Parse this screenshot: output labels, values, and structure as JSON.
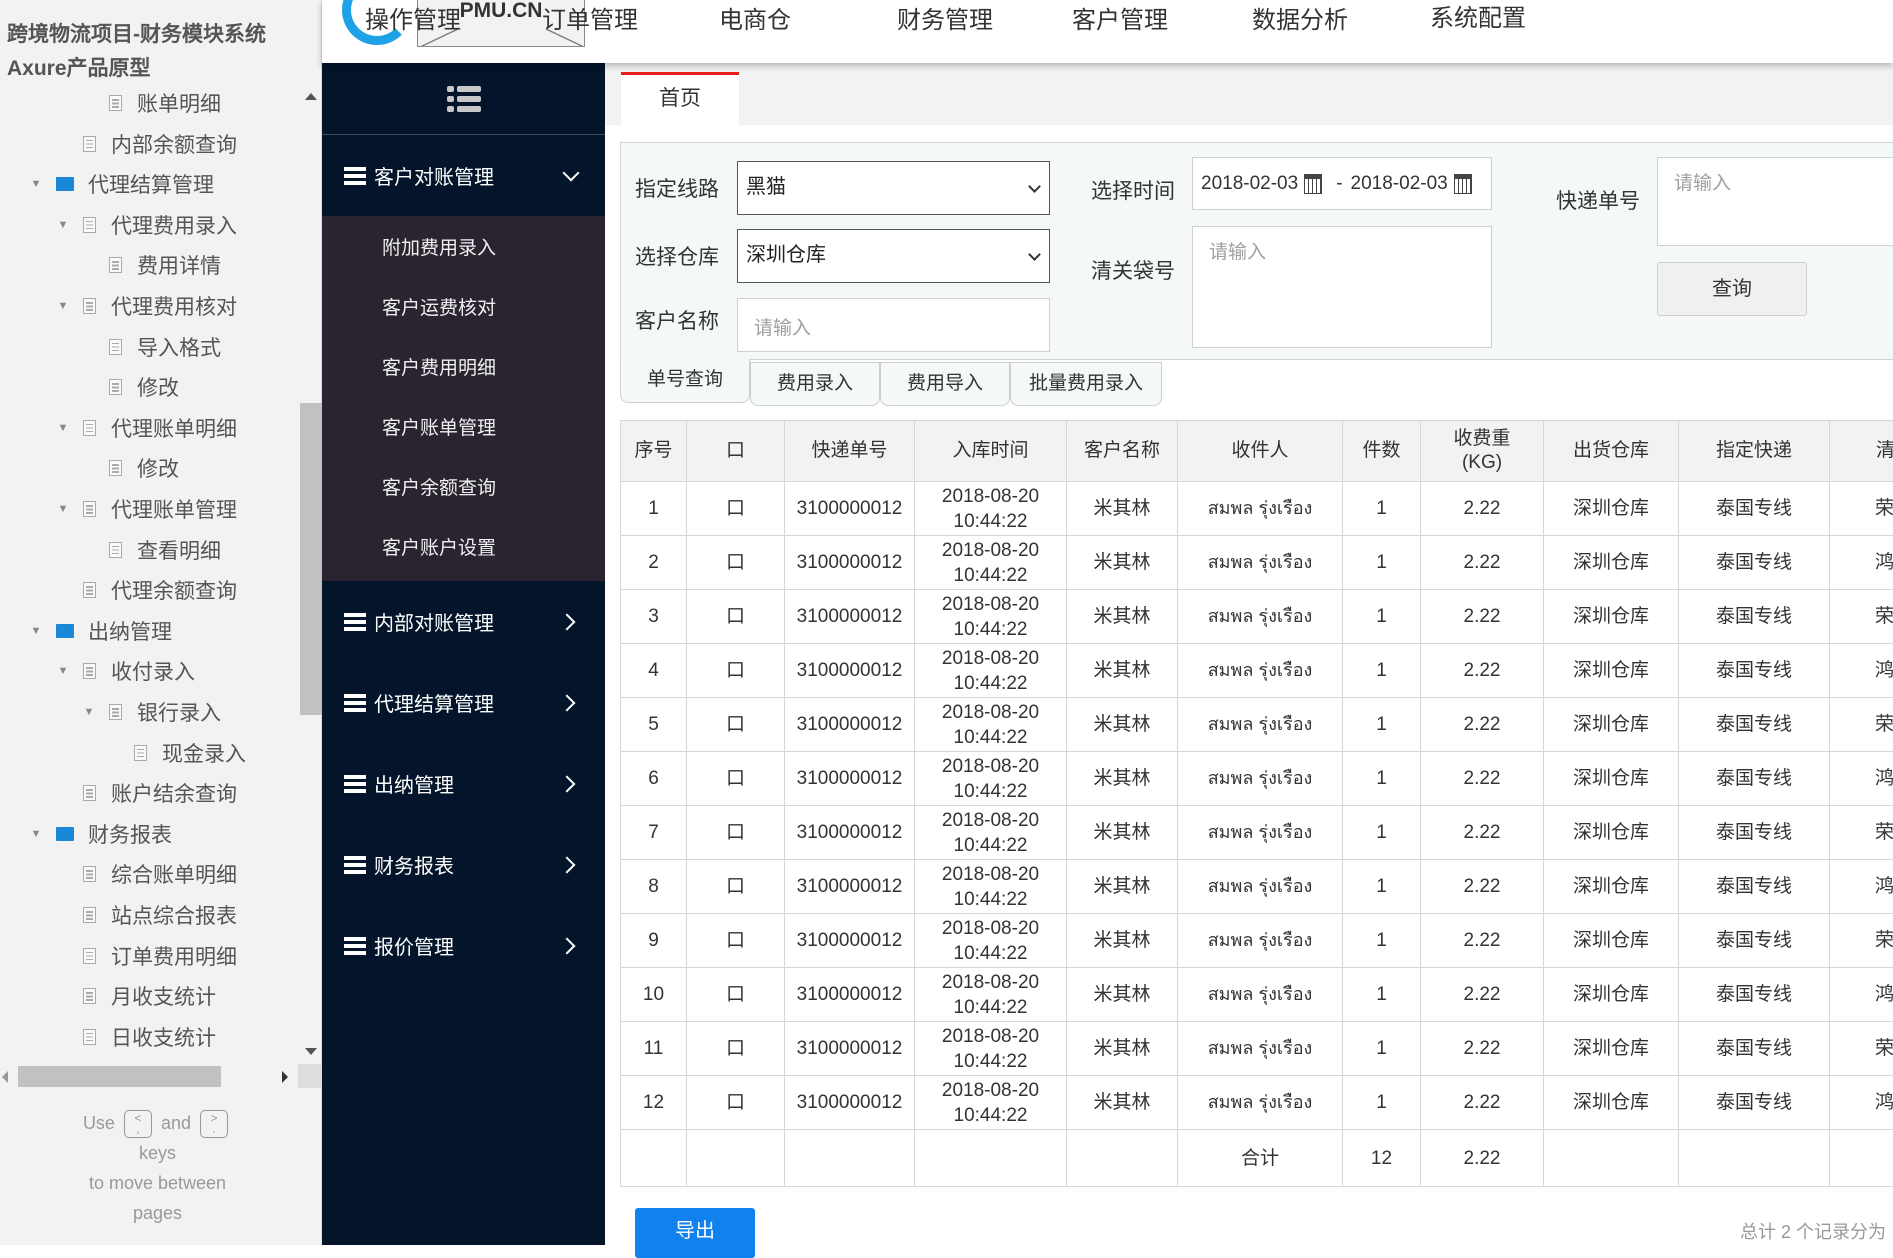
{
  "axure": {
    "project_title": "跨境物流项目-财务模块系统Axure产品原型",
    "tree": [
      {
        "label": "账单明细",
        "level": 3,
        "type": "page",
        "expander": false
      },
      {
        "label": "内部余额查询",
        "level": 2,
        "type": "page",
        "expander": false
      },
      {
        "label": "代理结算管理",
        "level": 1,
        "type": "folder",
        "expander": true
      },
      {
        "label": "代理费用录入",
        "level": 2,
        "type": "page",
        "expander": true
      },
      {
        "label": "费用详情",
        "level": 3,
        "type": "page",
        "expander": false
      },
      {
        "label": "代理费用核对",
        "level": 2,
        "type": "page",
        "expander": true
      },
      {
        "label": "导入格式",
        "level": 3,
        "type": "page",
        "expander": false
      },
      {
        "label": "修改",
        "level": 3,
        "type": "page",
        "expander": false
      },
      {
        "label": "代理账单明细",
        "level": 2,
        "type": "page",
        "expander": true
      },
      {
        "label": "修改",
        "level": 3,
        "type": "page",
        "expander": false
      },
      {
        "label": "代理账单管理",
        "level": 2,
        "type": "page",
        "expander": true
      },
      {
        "label": "查看明细",
        "level": 3,
        "type": "page",
        "expander": false
      },
      {
        "label": "代理余额查询",
        "level": 2,
        "type": "page",
        "expander": false
      },
      {
        "label": "出纳管理",
        "level": 1,
        "type": "folder",
        "expander": true
      },
      {
        "label": "收付录入",
        "level": 2,
        "type": "page",
        "expander": true
      },
      {
        "label": "银行录入",
        "level": 3,
        "type": "page",
        "expander": true
      },
      {
        "label": "现金录入",
        "level": 4,
        "type": "page",
        "expander": false
      },
      {
        "label": "账户结余查询",
        "level": 2,
        "type": "page",
        "expander": false
      },
      {
        "label": "财务报表",
        "level": 1,
        "type": "folder",
        "expander": true
      },
      {
        "label": "综合账单明细",
        "level": 2,
        "type": "page",
        "expander": false
      },
      {
        "label": "站点综合报表",
        "level": 2,
        "type": "page",
        "expander": false
      },
      {
        "label": "订单费用明细",
        "level": 2,
        "type": "page",
        "expander": false
      },
      {
        "label": "月收支统计",
        "level": 2,
        "type": "page",
        "expander": false
      },
      {
        "label": "日收支统计",
        "level": 2,
        "type": "page",
        "expander": false
      }
    ],
    "hint": {
      "use": "Use",
      "and": "and",
      "key_prev": "<\n,",
      "key_next": ">\n.",
      "keys": "keys",
      "line2": "to move between",
      "line3": "pages"
    }
  },
  "header": {
    "logo_text": "PMU.CN",
    "nav": [
      "操作管理",
      "订单管理",
      "电商仓",
      "财务管理",
      "客户管理",
      "数据分析",
      "系统配置"
    ]
  },
  "sidenav": {
    "groups": [
      {
        "label": "客户对账管理",
        "expanded": true,
        "items": [
          "附加费用录入",
          "客户运费核对",
          "客户费用明细",
          "客户账单管理",
          "客户余额查询",
          "客户账户设置"
        ]
      },
      {
        "label": "内部对账管理",
        "expanded": false
      },
      {
        "label": "代理结算管理",
        "expanded": false
      },
      {
        "label": "出纳管理",
        "expanded": false
      },
      {
        "label": "财务报表",
        "expanded": false
      },
      {
        "label": "报价管理",
        "expanded": false
      }
    ]
  },
  "tabs": {
    "home": "首页"
  },
  "filter": {
    "route_label": "指定线路",
    "route_value": "黑猫",
    "warehouse_label": "选择仓库",
    "warehouse_value": "深圳仓库",
    "customer_label": "客户名称",
    "customer_placeholder": "请输入",
    "time_label": "选择时间",
    "date_from": "2018-02-03",
    "date_sep": "-",
    "date_to": "2018-02-03",
    "bag_label": "清关袋号",
    "bag_placeholder": "请输入",
    "tracking_label": "快递单号",
    "tracking_placeholder": "请输入",
    "query_button": "查询"
  },
  "query_tabs": [
    "单号查询",
    "费用录入",
    "费用导入",
    "批量费用录入"
  ],
  "table": {
    "columns": [
      "序号",
      "口",
      "快递单号",
      "入库时间",
      "客户名称",
      "收件人",
      "件数",
      "收费重\n(KG)",
      "出货仓库",
      "指定快递",
      "清关"
    ],
    "rows": [
      [
        "1",
        "口",
        "3100000012",
        "2018-08-20\n10:44:22",
        "米其林",
        "สมพล รุ่งเรือง",
        "1",
        "2.22",
        "深圳仓库",
        "泰国专线",
        "荣"
      ],
      [
        "2",
        "口",
        "3100000012",
        "2018-08-20\n10:44:22",
        "米其林",
        "สมพล รุ่งเรือง",
        "1",
        "2.22",
        "深圳仓库",
        "泰国专线",
        "鸿"
      ],
      [
        "3",
        "口",
        "3100000012",
        "2018-08-20\n10:44:22",
        "米其林",
        "สมพล รุ่งเรือง",
        "1",
        "2.22",
        "深圳仓库",
        "泰国专线",
        "荣"
      ],
      [
        "4",
        "口",
        "3100000012",
        "2018-08-20\n10:44:22",
        "米其林",
        "สมพล รุ่งเรือง",
        "1",
        "2.22",
        "深圳仓库",
        "泰国专线",
        "鸿"
      ],
      [
        "5",
        "口",
        "3100000012",
        "2018-08-20\n10:44:22",
        "米其林",
        "สมพล รุ่งเรือง",
        "1",
        "2.22",
        "深圳仓库",
        "泰国专线",
        "荣"
      ],
      [
        "6",
        "口",
        "3100000012",
        "2018-08-20\n10:44:22",
        "米其林",
        "สมพล รุ่งเรือง",
        "1",
        "2.22",
        "深圳仓库",
        "泰国专线",
        "鸿"
      ],
      [
        "7",
        "口",
        "3100000012",
        "2018-08-20\n10:44:22",
        "米其林",
        "สมพล รุ่งเรือง",
        "1",
        "2.22",
        "深圳仓库",
        "泰国专线",
        "荣"
      ],
      [
        "8",
        "口",
        "3100000012",
        "2018-08-20\n10:44:22",
        "米其林",
        "สมพล รุ่งเรือง",
        "1",
        "2.22",
        "深圳仓库",
        "泰国专线",
        "鸿"
      ],
      [
        "9",
        "口",
        "3100000012",
        "2018-08-20\n10:44:22",
        "米其林",
        "สมพล รุ่งเรือง",
        "1",
        "2.22",
        "深圳仓库",
        "泰国专线",
        "荣"
      ],
      [
        "10",
        "口",
        "3100000012",
        "2018-08-20\n10:44:22",
        "米其林",
        "สมพล รุ่งเรือง",
        "1",
        "2.22",
        "深圳仓库",
        "泰国专线",
        "鸿"
      ],
      [
        "11",
        "口",
        "3100000012",
        "2018-08-20\n10:44:22",
        "米其林",
        "สมพล รุ่งเรือง",
        "1",
        "2.22",
        "深圳仓库",
        "泰国专线",
        "荣"
      ],
      [
        "12",
        "口",
        "3100000012",
        "2018-08-20\n10:44:22",
        "米其林",
        "สมพล รุ่งเรือง",
        "1",
        "2.22",
        "深圳仓库",
        "泰国专线",
        "鸿"
      ]
    ],
    "total": {
      "label": "合计",
      "count": "12",
      "weight": "2.22"
    }
  },
  "footer": {
    "export_button": "导出",
    "page_info": "总计 2 个记录分为"
  },
  "colors": {
    "accent_blue": "#1081ee",
    "nav_dark": "#04152b",
    "nav_sub": "#29242f",
    "tab_active": "#e81e1e",
    "folder_blue": "#1a87d9"
  }
}
